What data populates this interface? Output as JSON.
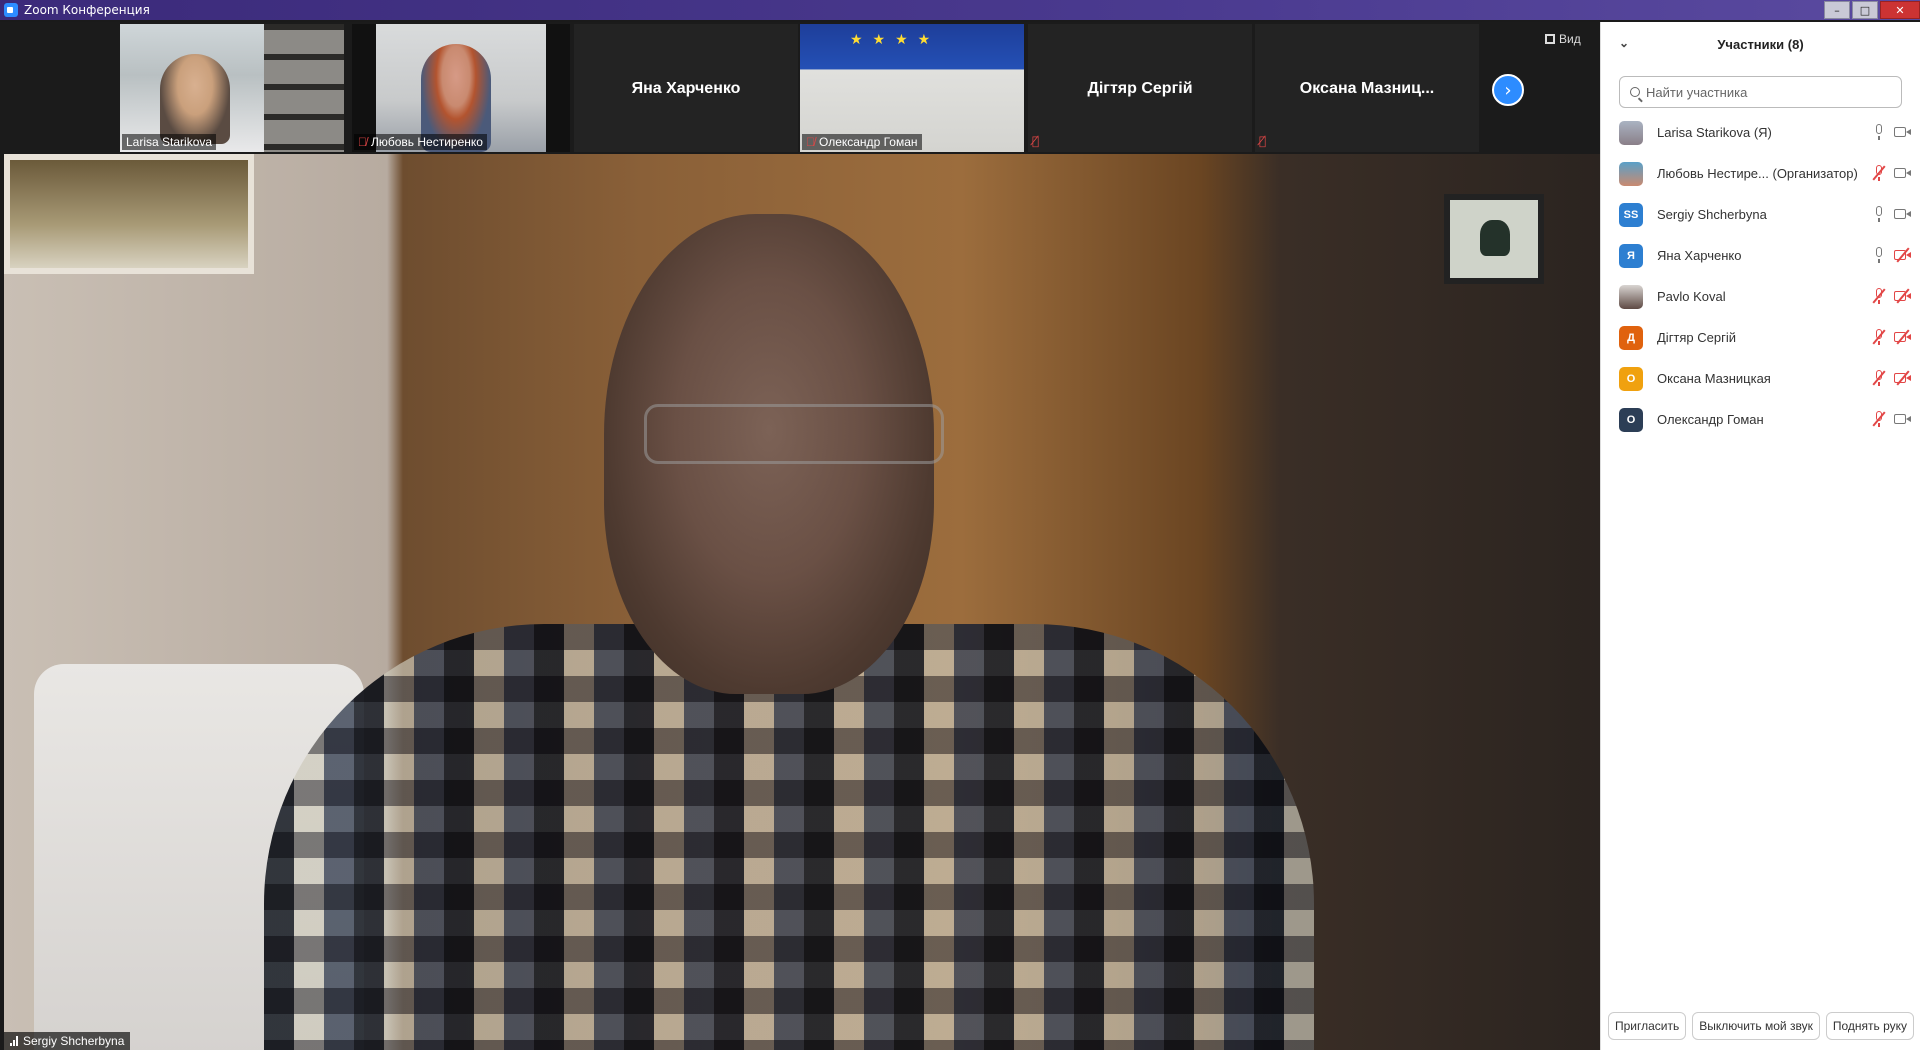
{
  "window": {
    "title": "Zoom Конференция",
    "controls": {
      "minimize": "–",
      "maximize": "□",
      "close": "✕"
    }
  },
  "gallery": {
    "tiles": [
      {
        "name": "Larisa Starikova",
        "has_video": true,
        "muted": false
      },
      {
        "name": "Любовь Нестиренко",
        "has_video": true,
        "muted": true
      },
      {
        "name": "Яна Харченко",
        "has_video": false,
        "muted": false
      },
      {
        "name": "Олександр Гоман",
        "has_video": true,
        "muted": true
      },
      {
        "name": "Дігтяр Сергій",
        "has_video": false,
        "muted": true
      },
      {
        "name": "Оксана  Мазниц...",
        "has_video": false,
        "muted": true
      }
    ],
    "next_icon": "chevron-right-icon",
    "view_label": "Вид"
  },
  "main_video": {
    "speaker_name": "Sergiy Shcherbyna"
  },
  "participants": {
    "title": "Участники (8)",
    "search_placeholder": "Найти участника",
    "list": [
      {
        "name": "Larisa Starikova (Я)",
        "avatar": "",
        "avatar_color": "",
        "mic": "on",
        "cam": "on"
      },
      {
        "name": "Любовь Нестире... (Организатор)",
        "avatar": "",
        "avatar_color": "",
        "mic": "muted",
        "cam": "on"
      },
      {
        "name": "Sergiy Shcherbyna",
        "avatar": "SS",
        "avatar_color": "#2d7fd1",
        "mic": "on",
        "cam": "on"
      },
      {
        "name": "Яна Харченко",
        "avatar": "Я",
        "avatar_color": "#2d7fd1",
        "mic": "on",
        "cam": "off"
      },
      {
        "name": "Pavlo Koval",
        "avatar": "",
        "avatar_color": "",
        "mic": "muted",
        "cam": "off"
      },
      {
        "name": "Дігтяр Сергій",
        "avatar": "Д",
        "avatar_color": "#e0620e",
        "mic": "muted",
        "cam": "off"
      },
      {
        "name": "Оксана Мазницкая",
        "avatar": "О",
        "avatar_color": "#f0a10f",
        "mic": "muted",
        "cam": "off"
      },
      {
        "name": "Олександр Гоман",
        "avatar": "О",
        "avatar_color": "#2c3e56",
        "mic": "muted",
        "cam": "on"
      }
    ],
    "footer": {
      "invite": "Пригласить",
      "mute_me": "Выключить мой звук",
      "raise_hand": "Поднять руку"
    }
  },
  "colors": {
    "accent": "#2d8cff",
    "muted_red": "#e24646",
    "titlebar": "#3b2a7a"
  }
}
